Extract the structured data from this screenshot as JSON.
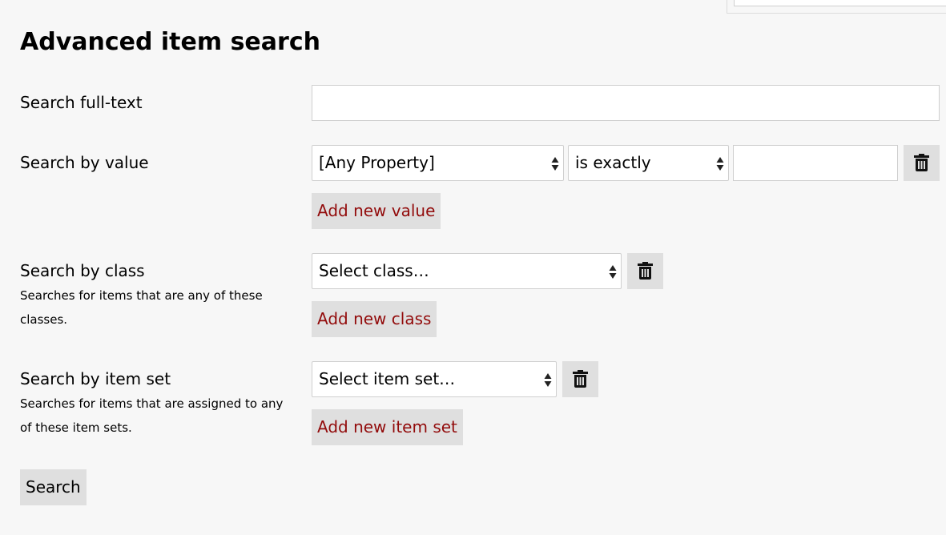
{
  "page": {
    "title": "Advanced item search"
  },
  "fulltext": {
    "label": "Search full-text",
    "value": ""
  },
  "value_search": {
    "label": "Search by value",
    "property_select": "[Any Property]",
    "operator_select": "is exactly",
    "value": "",
    "add_label": "Add new value"
  },
  "class_search": {
    "label": "Search by class",
    "description": "Searches for items that are any of these classes.",
    "select": "Select class…",
    "add_label": "Add new class"
  },
  "itemset_search": {
    "label": "Search by item set",
    "description": "Searches for items that are assigned to any of these item sets.",
    "select": "Select item set…",
    "add_label": "Add new item set"
  },
  "submit": {
    "label": "Search"
  },
  "icons": {
    "remove": "trash-icon",
    "select": "up-down-arrows-icon"
  },
  "colors": {
    "background": "#f7f7f7",
    "button_bg": "#dfdfdf",
    "accent_text": "#920b0b"
  }
}
